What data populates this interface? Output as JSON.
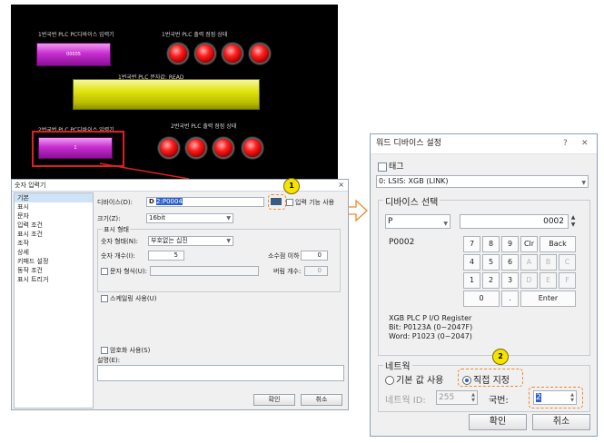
{
  "hmi": {
    "label_input1": "1번국번 PLC PC디바이스 입력기",
    "label_output1": "1번국번 PLC 출력 점점 상태",
    "btn1_value": "00005",
    "label_string_read": "1번국번 PLC 문자값: READ",
    "label_input2": "2번국번 PLC PC디바이스 입력기",
    "label_output2": "2번국번 PLC 출력 점점 상태",
    "btn2_value": "1"
  },
  "numeric_dialog": {
    "title": "숫자 입력기",
    "categories": [
      "기본",
      "표시",
      "문자",
      "입력 조건",
      "표시 조건",
      "조작",
      "상세",
      "키패드 설정",
      "동작 조건",
      "표시 트리거"
    ],
    "device_label": "디바이스(D):",
    "device_value_prefix": "D",
    "device_value": "2:P0004",
    "input_enable_label": "입력 기능 사용",
    "size_label": "크기(Z):",
    "size_value": "16bit",
    "display_format_group": "표시 형태",
    "num_format_label": "숫자 형태(N):",
    "num_format_value": "부호없는 십진",
    "digit_count_label": "숫자 개수(I):",
    "digit_count_value": "5",
    "decimal_label": "소수점 이하 개수",
    "decimal_value": "0",
    "string_format_label": "문자 형식(U):",
    "fill_label": "버림 개수:",
    "fill_value": "0",
    "scaling_label": "스케일링 사용(U)",
    "password_label": "암호화 사용(S)",
    "desc_label": "설명(E):",
    "ok": "확인",
    "cancel": "취소"
  },
  "word_dialog": {
    "title": "워드 디바이스 설정",
    "help": "?",
    "close": "✕",
    "tag_label": "태그",
    "connection_value": "0: LSIS: XGB (LINK)",
    "device_select_label": "디바이스 선택",
    "device_type": "P",
    "address_value": "0002",
    "current_address": "P0002",
    "keys": [
      "7",
      "8",
      "9",
      "Clr",
      "Back",
      "4",
      "5",
      "6",
      "A",
      "B",
      "C",
      "1",
      "2",
      "3",
      "D",
      "E",
      "F",
      "0",
      ".",
      "Enter"
    ],
    "info_line1": "XGB PLC P I/O Register",
    "info_line2": "Bit: P0123A (0~2047F)",
    "info_line3": "Word: P1023 (0~2047)",
    "network_label": "네트웍",
    "radio_default": "기본 값 사용",
    "radio_direct": "직접 지정",
    "network_id_label": "네트웍 ID:",
    "network_id_value": "255",
    "station_label": "국번:",
    "station_value": "2",
    "ok": "확인",
    "cancel": "취소"
  },
  "badges": {
    "b1": "1",
    "b2": "2"
  },
  "colors": {
    "annotation": "#ee8a2e",
    "badge": "#f6e300",
    "selection": "#e02020"
  }
}
